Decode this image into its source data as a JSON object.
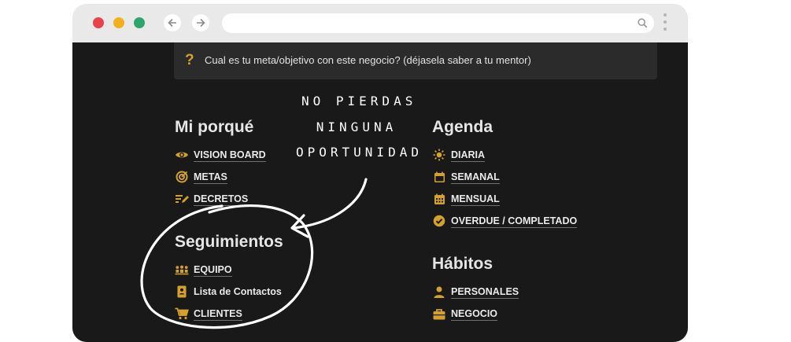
{
  "callout": {
    "icon": "question-icon",
    "text": "Cual es tu meta/objetivo con este negocio? (déjasela saber a tu mentor)"
  },
  "annotation": {
    "line1": "NO PIERDAS",
    "line2": "NINGUNA",
    "line3": "OPORTUNIDAD"
  },
  "sections": {
    "porque": {
      "title": "Mi porqué",
      "items": [
        {
          "label": "VISION BOARD",
          "icon": "eye-icon"
        },
        {
          "label": "METAS",
          "icon": "target-icon"
        },
        {
          "label": "DECRETOS",
          "icon": "edit-list-icon"
        }
      ]
    },
    "agenda": {
      "title": "Agenda",
      "items": [
        {
          "label": "DIARIA",
          "icon": "sun-icon"
        },
        {
          "label": "SEMANAL",
          "icon": "calendar-icon"
        },
        {
          "label": "MENSUAL",
          "icon": "calendar-grid-icon"
        },
        {
          "label": "OVERDUE / COMPLETADO",
          "icon": "check-circle-icon"
        }
      ]
    },
    "seguimientos": {
      "title": "Seguimientos",
      "items": [
        {
          "label": "EQUIPO",
          "icon": "team-icon"
        },
        {
          "label": "Lista de Contactos",
          "icon": "contacts-icon"
        },
        {
          "label": "CLIENTES",
          "icon": "cart-icon"
        }
      ]
    },
    "habitos": {
      "title": "Hábitos",
      "items": [
        {
          "label": "PERSONALES",
          "icon": "person-icon"
        },
        {
          "label": "NEGOCIO",
          "icon": "briefcase-icon"
        }
      ]
    }
  },
  "colors": {
    "accent": "#d4a12d",
    "background": "#191919",
    "callout_bg": "#2b2b2b",
    "frame": "#e9e9e9"
  }
}
